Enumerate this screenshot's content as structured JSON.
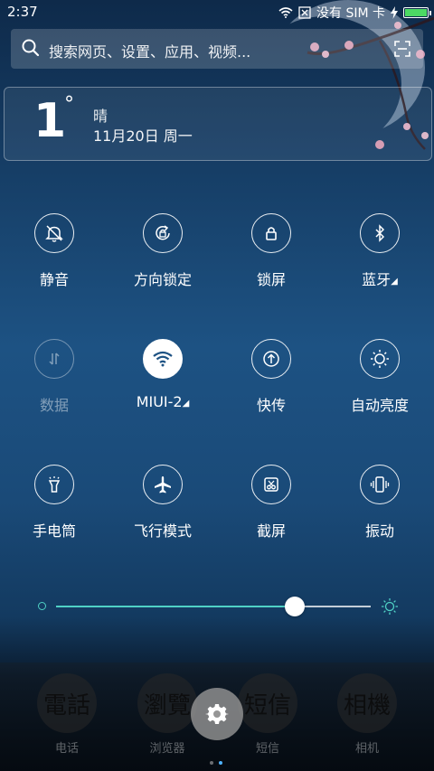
{
  "status_bar": {
    "time": "2:37",
    "carrier": "没有 SIM 卡",
    "battery_level": 1.0
  },
  "search": {
    "placeholder": "搜索网页、设置、应用、视频..."
  },
  "weather": {
    "temperature": "1",
    "degree_symbol": "°",
    "condition": "晴",
    "date": "11月20日 周一"
  },
  "toggles": [
    {
      "label": "静音",
      "icon": "mute-bell-icon",
      "state": "off"
    },
    {
      "label": "方向锁定",
      "icon": "rotation-lock-icon",
      "state": "off"
    },
    {
      "label": "锁屏",
      "icon": "lock-icon",
      "state": "off"
    },
    {
      "label": "蓝牙",
      "icon": "bluetooth-icon",
      "state": "off",
      "has_menu": true
    },
    {
      "label": "数据",
      "icon": "mobile-data-icon",
      "state": "disabled"
    },
    {
      "label": "MIUI-2",
      "icon": "wifi-icon",
      "state": "on",
      "has_menu": true
    },
    {
      "label": "快传",
      "icon": "quick-transfer-icon",
      "state": "off"
    },
    {
      "label": "自动亮度",
      "icon": "auto-brightness-icon",
      "state": "off"
    },
    {
      "label": "手电筒",
      "icon": "flashlight-icon",
      "state": "off"
    },
    {
      "label": "飞行模式",
      "icon": "airplane-icon",
      "state": "off"
    },
    {
      "label": "截屏",
      "icon": "screenshot-icon",
      "state": "off"
    },
    {
      "label": "振动",
      "icon": "vibrate-icon",
      "state": "off"
    }
  ],
  "brightness": {
    "level": 0.76,
    "min_icon": "brightness-low-icon",
    "max_icon": "brightness-high-icon"
  },
  "dock": {
    "apps": [
      {
        "label": "电话",
        "art": "電話"
      },
      {
        "label": "浏览器",
        "art": "瀏覽"
      },
      {
        "label": "短信",
        "art": "短信"
      },
      {
        "label": "相机",
        "art": "相機"
      }
    ],
    "settings_icon": "gear-icon",
    "page_count": 2,
    "active_page": 2
  },
  "colors": {
    "accent": "#4fd1c5",
    "battery": "#4cd964",
    "page_indicator_active": "#4fb3ff"
  }
}
